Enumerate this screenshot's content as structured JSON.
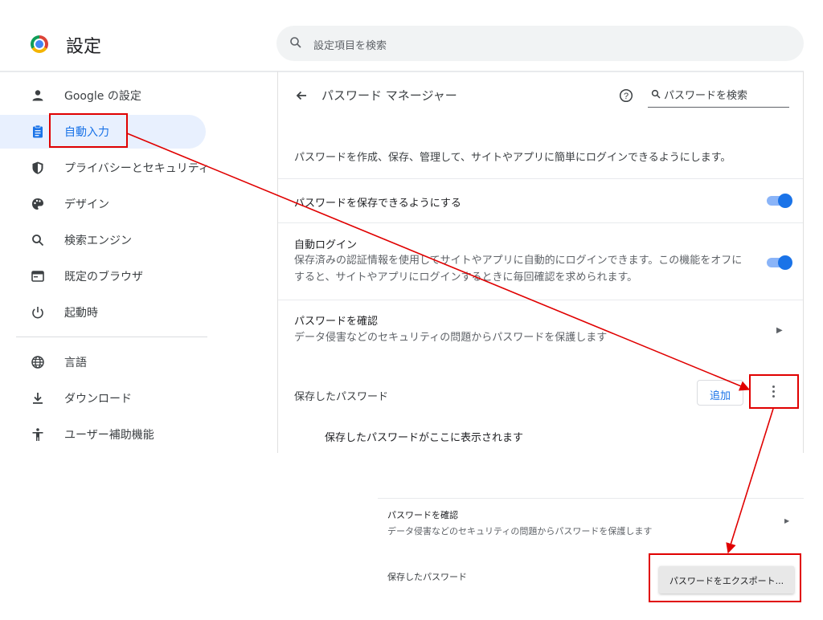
{
  "header": {
    "title": "設定",
    "search_placeholder": "設定項目を検索"
  },
  "sidebar": {
    "items": [
      {
        "label": "Google の設定",
        "icon": "person-icon"
      },
      {
        "label": "自動入力",
        "icon": "clipboard-icon",
        "active": true
      },
      {
        "label": "プライバシーとセキュリティ",
        "icon": "shield-icon"
      },
      {
        "label": "デザイン",
        "icon": "palette-icon"
      },
      {
        "label": "検索エンジン",
        "icon": "search-icon"
      },
      {
        "label": "既定のブラウザ",
        "icon": "browser-icon"
      },
      {
        "label": "起動時",
        "icon": "power-icon"
      },
      {
        "label": "言語",
        "icon": "globe-icon"
      },
      {
        "label": "ダウンロード",
        "icon": "download-icon"
      },
      {
        "label": "ユーザー補助機能",
        "icon": "accessibility-icon"
      }
    ]
  },
  "main": {
    "title": "パスワード マネージャー",
    "search_placeholder": "パスワードを検索",
    "intro": "パスワードを作成、保存、管理して、サイトやアプリに簡単にログインできるようにします。",
    "offer_to_save": {
      "label": "パスワードを保存できるようにする",
      "enabled": true
    },
    "auto_signin": {
      "label": "自動ログイン",
      "desc": "保存済みの認証情報を使用してサイトやアプリに自動的にログインできます。この機能をオフにすると、サイトやアプリにログインするときに毎回確認を求められます。",
      "enabled": true
    },
    "check_passwords": {
      "label": "パスワードを確認",
      "desc": "データ侵害などのセキュリティの問題からパスワードを保護します"
    },
    "saved_passwords_label": "保存したパスワード",
    "add_button": "追加",
    "empty_message": "保存したパスワードがここに表示されます"
  },
  "inset": {
    "check_title": "パスワードを確認",
    "check_desc": "データ侵害などのセキュリティの問題からパスワードを保護します",
    "saved_label": "保存したパスワード",
    "export_menu_item": "パスワードをエクスポート..."
  },
  "colors": {
    "accent": "#1a73e8",
    "active_bg": "#e8f0fe",
    "highlight": "#e00000"
  }
}
